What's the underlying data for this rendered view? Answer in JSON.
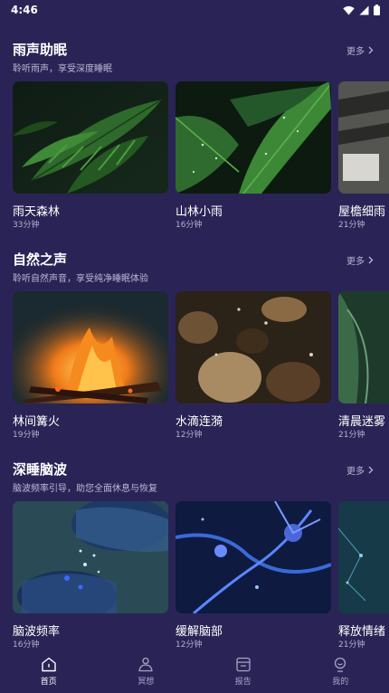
{
  "status_bar": {
    "time": "4:46",
    "icons": [
      "wifi-icon",
      "signal-icon",
      "battery-icon"
    ]
  },
  "sections": [
    {
      "title": "雨声助眠",
      "subtitle": "聆听雨声，享受深度睡眠",
      "more_label": "更多",
      "cards": [
        {
          "title": "雨天森林",
          "duration": "33分钟"
        },
        {
          "title": "山林小雨",
          "duration": "16分钟"
        },
        {
          "title": "屋檐细雨",
          "duration": "21分钟"
        }
      ]
    },
    {
      "title": "自然之声",
      "subtitle": "聆听自然声音，享受纯净睡眠体验",
      "more_label": "更多",
      "cards": [
        {
          "title": "林间篝火",
          "duration": "19分钟"
        },
        {
          "title": "水滴连漪",
          "duration": "12分钟"
        },
        {
          "title": "清晨迷雾",
          "duration": "21分钟"
        }
      ]
    },
    {
      "title": "深睡脑波",
      "subtitle": "脑波频率引导，助您全面休息与恢复",
      "more_label": "更多",
      "cards": [
        {
          "title": "脑波频率",
          "duration": "16分钟"
        },
        {
          "title": "缓解脑部",
          "duration": "12分钟"
        },
        {
          "title": "释放情绪",
          "duration": "21分钟"
        }
      ]
    }
  ],
  "tabs": [
    {
      "label": "首页",
      "icon": "home-icon",
      "active": true
    },
    {
      "label": "冥想",
      "icon": "meditation-icon",
      "active": false
    },
    {
      "label": "报告",
      "icon": "report-icon",
      "active": false
    },
    {
      "label": "我的",
      "icon": "profile-icon",
      "active": false
    }
  ],
  "colors": {
    "background": "#2a2456",
    "text_secondary": "#bdb8d6",
    "tab_inactive": "#a9a3c9"
  }
}
